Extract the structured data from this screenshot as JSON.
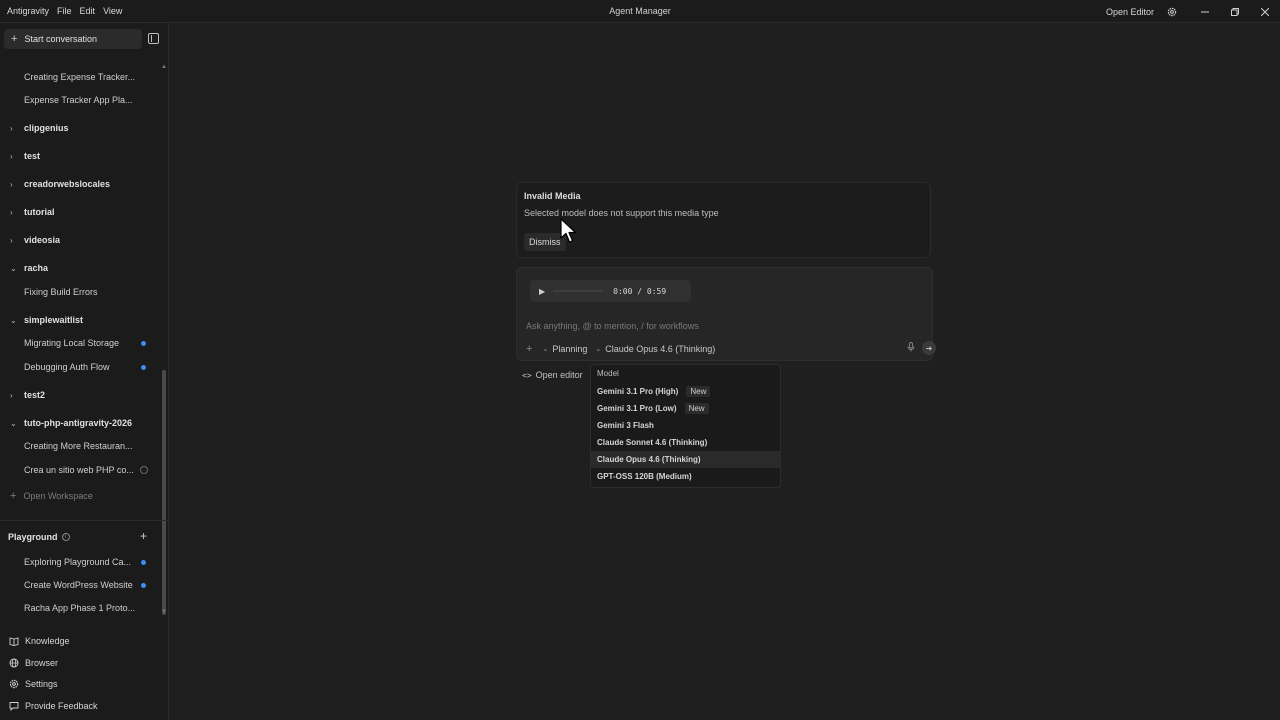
{
  "titlebar": {
    "menu": [
      "Antigravity",
      "File",
      "Edit",
      "View"
    ],
    "title": "Agent Manager",
    "open_editor": "Open Editor"
  },
  "sidebar": {
    "start_conversation": "Start conversation",
    "tree": [
      {
        "type": "child",
        "label": "Creating Expense Tracker..."
      },
      {
        "type": "child",
        "label": "Expense Tracker App Pla..."
      },
      {
        "type": "folder",
        "expanded": false,
        "label": "clipgenius"
      },
      {
        "type": "folder",
        "expanded": false,
        "label": "test"
      },
      {
        "type": "folder",
        "expanded": false,
        "label": "creadorwebslocales"
      },
      {
        "type": "folder",
        "expanded": false,
        "label": "tutorial"
      },
      {
        "type": "folder",
        "expanded": false,
        "label": "videosia"
      },
      {
        "type": "folder",
        "expanded": true,
        "label": "racha"
      },
      {
        "type": "child",
        "label": "Fixing Build Errors"
      },
      {
        "type": "folder",
        "expanded": true,
        "label": "simplewaitlist"
      },
      {
        "type": "child",
        "label": "Migrating Local Storage",
        "indicator": "dot"
      },
      {
        "type": "child",
        "label": "Debugging Auth Flow",
        "indicator": "dot"
      },
      {
        "type": "folder",
        "expanded": false,
        "label": "test2"
      },
      {
        "type": "folder",
        "expanded": true,
        "label": "tuto-php-antigravity-2026"
      },
      {
        "type": "child",
        "label": "Creating More Restauran..."
      },
      {
        "type": "child",
        "label": "Crea un sitio web PHP co...",
        "indicator": "ring"
      }
    ],
    "open_workspace": "Open Workspace",
    "playground": {
      "title": "Playground",
      "items": [
        {
          "label": "Exploring Playground Ca...",
          "indicator": "dot"
        },
        {
          "label": "Create WordPress Website",
          "indicator": "dot"
        },
        {
          "label": "Racha App Phase 1 Proto..."
        }
      ]
    },
    "bottom_nav": [
      {
        "icon": "book-icon",
        "label": "Knowledge"
      },
      {
        "icon": "globe-icon",
        "label": "Browser"
      },
      {
        "icon": "gear-icon",
        "label": "Settings"
      },
      {
        "icon": "feedback-icon",
        "label": "Provide Feedback"
      }
    ]
  },
  "toast": {
    "title": "Invalid Media",
    "message": "Selected model does not support this media type",
    "dismiss": "Dismiss"
  },
  "composer": {
    "audio_time": "0:00 / 0:59",
    "placeholder": "Ask anything, @ to mention, / for workflows",
    "mode": "Planning",
    "model": "Claude Opus 4.6 (Thinking)"
  },
  "under_composer": {
    "open_editor": "Open editor"
  },
  "model_menu": {
    "title": "Model",
    "items": [
      {
        "label": "Gemini 3.1 Pro (High)",
        "badge": "New"
      },
      {
        "label": "Gemini 3.1 Pro (Low)",
        "badge": "New"
      },
      {
        "label": "Gemini 3 Flash"
      },
      {
        "label": "Claude Sonnet 4.6 (Thinking)"
      },
      {
        "label": "Claude Opus 4.6 (Thinking)",
        "selected": true
      },
      {
        "label": "GPT-OSS 120B (Medium)"
      }
    ]
  },
  "colors": {
    "background": "#1f1f1f",
    "sidebar": "#1b1b1b",
    "accent_dot": "#3b8ff0"
  }
}
